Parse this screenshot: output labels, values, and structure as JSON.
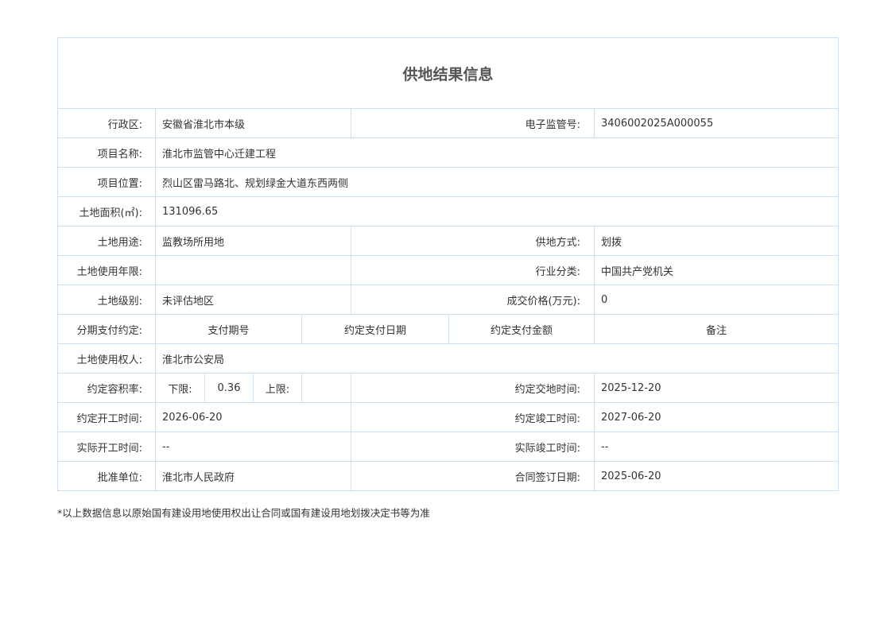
{
  "title": "供地结果信息",
  "rows": {
    "district": {
      "label": "行政区:",
      "value": "安徽省淮北市本级"
    },
    "supervision_no": {
      "label": "电子监管号:",
      "value": "3406002025A000055"
    },
    "project_name": {
      "label": "项目名称:",
      "value": "淮北市监管中心迁建工程"
    },
    "project_location": {
      "label": "项目位置:",
      "value": "烈山区雷马路北、规划绿金大道东西两侧"
    },
    "land_area": {
      "label": "土地面积(㎡):",
      "value": "131096.65"
    },
    "land_use": {
      "label": "土地用途:",
      "value": "监教场所用地"
    },
    "supply_method": {
      "label": "供地方式:",
      "value": "划拨"
    },
    "use_term": {
      "label": "土地使用年限:",
      "value": ""
    },
    "industry": {
      "label": "行业分类:",
      "value": "中国共产党机关"
    },
    "land_grade": {
      "label": "土地级别:",
      "value": "未评估地区"
    },
    "deal_price": {
      "label": "成交价格(万元):",
      "value": "0"
    },
    "installments": {
      "label": "分期支付约定:",
      "headers": [
        "支付期号",
        "约定支付日期",
        "约定支付金额",
        "备注"
      ]
    },
    "land_user": {
      "label": "土地使用权人:",
      "value": "淮北市公安局"
    },
    "plot_ratio": {
      "label": "约定容积率:",
      "lower_label": "下限:",
      "lower_value": "0.36",
      "upper_label": "上限:",
      "upper_value": ""
    },
    "delivery_time": {
      "label": "约定交地时间:",
      "value": "2025-12-20"
    },
    "start_time": {
      "label": "约定开工时间:",
      "value": "2026-06-20"
    },
    "completion_time": {
      "label": "约定竣工时间:",
      "value": "2027-06-20"
    },
    "actual_start": {
      "label": "实际开工时间:",
      "value": "--"
    },
    "actual_completion": {
      "label": "实际竣工时间:",
      "value": "--"
    },
    "approval_unit": {
      "label": "批准单位:",
      "value": "淮北市人民政府"
    },
    "contract_date": {
      "label": "合同签订日期:",
      "value": "2025-06-20"
    }
  },
  "footnote": "*以上数据信息以原始国有建设用地使用权出让合同或国有建设用地划拨决定书等为准"
}
